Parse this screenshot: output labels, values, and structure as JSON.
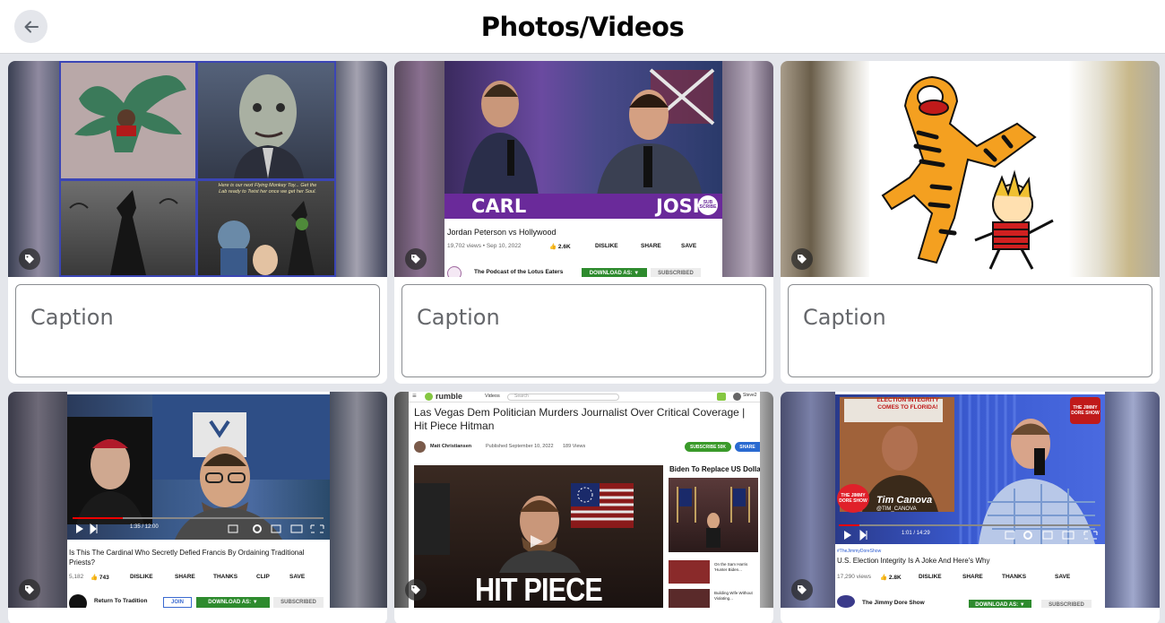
{
  "header": {
    "title": "Photos/Videos",
    "back_icon": "arrow-left-icon"
  },
  "colors": {
    "background": "#e4e6eb",
    "card": "#ffffff",
    "caption_border": "#8a8d91",
    "caption_text": "#65676b"
  },
  "caption_placeholder": "Caption",
  "tag_icon": "tag-icon",
  "items": [
    {
      "collage_text": "Here is our next Flying Monkey Toy... Get the Lab ready to Twist her once we get her Soul."
    },
    {
      "name_left": "CARL",
      "name_right": "JOSH",
      "badge": "SUB SCRIBE",
      "video_title": "Jordan Peterson vs Hollywood",
      "meta": "19,702 views • Sep 10, 2022",
      "likes": "2.6K",
      "dislike": "DISLIKE",
      "share": "SHARE",
      "save": "SAVE",
      "channel": "The Podcast of the Lotus Eaters",
      "download": "DOWNLOAD AS: ▼",
      "subscribed": "SUBSCRIBED"
    },
    {},
    {
      "video_title": "Is This The Cardinal Who Secretly Defied Francis By Ordaining Traditional Priests?",
      "views": "5,182",
      "likes": "743",
      "dislike": "DISLIKE",
      "share": "SHARE",
      "thanks": "THANKS",
      "clip": "CLIP",
      "save": "SAVE",
      "channel": "Return To Tradition",
      "join": "JOIN",
      "download": "DOWNLOAD AS: ▼",
      "subscribed": "SUBSCRIBED",
      "time": "1:35 / 12:00"
    },
    {
      "site": "rumble",
      "nav": "Videos",
      "search": "Search",
      "user": "Steve2",
      "video_title": "Las Vegas Dem Politician Murders Journalist Over Critical Coverage | Hit Piece Hitman",
      "channel": "Matt Christiansen",
      "published": "Published September 10, 2022",
      "views": "189 Views",
      "subscribe": "SUBSCRIBE 50K",
      "share": "SHARE",
      "headline": "HIT PIECE HITMAN",
      "side_title": "Biden To Replace US Dolla",
      "side_item1": "On the Sam Harris 'Hunter Biden...",
      "side_item2": "Building Wife Without Violating..."
    },
    {
      "show": "THE JIMMY DORE SHOW",
      "banner": "ELECTION INTEGRITY COMES TO FLORIDA!",
      "guest_name": "Tim Canova",
      "guest_handle": "@TIM_CANOVA",
      "hashtag": "#TheJimmyDoreShow",
      "video_title": "U.S. Election Integrity Is A Joke And Here's Why",
      "meta": "17,290 views",
      "likes": "2.8K",
      "dislike": "DISLIKE",
      "share": "SHARE",
      "thanks": "THANKS",
      "save": "SAVE",
      "channel": "The Jimmy Dore Show",
      "download": "DOWNLOAD AS: ▼",
      "subscribed": "SUBSCRIBED",
      "time": "1:01 / 14:29"
    }
  ]
}
